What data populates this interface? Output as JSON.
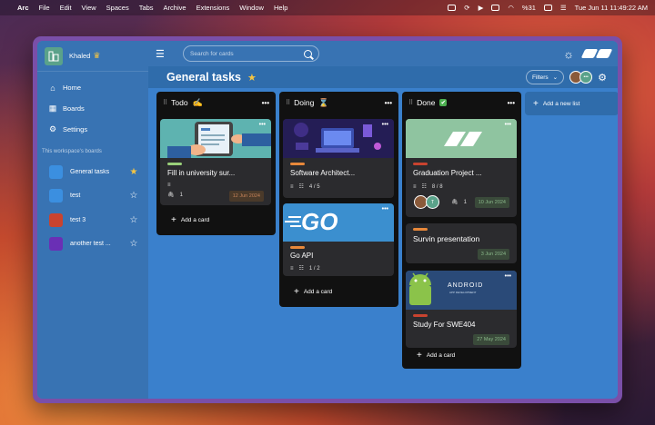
{
  "menubar": {
    "app": "Arc",
    "items": [
      "File",
      "Edit",
      "View",
      "Spaces",
      "Tabs",
      "Archive",
      "Extensions",
      "Window",
      "Help"
    ],
    "battery": "%31",
    "clock": "Tue Jun 11  11:49:22 AM"
  },
  "sidebar": {
    "workspace": "Khaled",
    "nav": [
      {
        "label": "Home",
        "icon": "home-icon"
      },
      {
        "label": "Boards",
        "icon": "boards-icon"
      },
      {
        "label": "Settings",
        "icon": "gear-icon"
      }
    ],
    "section_title": "This workspace's boards",
    "boards": [
      {
        "name": "General tasks",
        "color": "#3b8fe0",
        "starred": true
      },
      {
        "name": "test",
        "color": "#3b8fe0",
        "starred": false
      },
      {
        "name": "test 3",
        "color": "#c9432f",
        "starred": false
      },
      {
        "name": "another test ...",
        "color": "#6a2fb5",
        "starred": false
      }
    ]
  },
  "topbar": {
    "search_placeholder": "Search for cards"
  },
  "header": {
    "title": "General tasks",
    "filters": "Filters",
    "avatar_initial": "T"
  },
  "lists": [
    {
      "name": "Todo",
      "emoji": "✍️",
      "cards": [
        {
          "title": "Fill in university sur...",
          "label_color": "#9ad07a",
          "date": "12 Jun 2024",
          "attachments": "1"
        }
      ]
    },
    {
      "name": "Doing",
      "emoji": "⏳",
      "cards": [
        {
          "title": "Software Architect...",
          "label_color": "#e8883a",
          "checklist": "4 / 5"
        },
        {
          "title": "Go API",
          "label_color": "#e8883a",
          "checklist": "1 / 2",
          "image_text": "GO"
        }
      ]
    },
    {
      "name": "Done",
      "emoji": "✅",
      "cards": [
        {
          "title": "Graduation Project ...",
          "label_color": "#c9432f",
          "checklist": "8 / 8",
          "attachments": "1",
          "date": "10 Jun 2024",
          "avatar_initial": "T"
        },
        {
          "title": "Survin presentation",
          "label_color": "#e8883a",
          "date": "3 Jun 2024"
        },
        {
          "title": "Study For SWE404",
          "label_color": "#c9432f",
          "date": "27 May 2024",
          "image_text": "ANDROID",
          "image_subtext": "APP DEVELOPMENT"
        }
      ]
    }
  ],
  "add_card": "Add a card",
  "add_list": "Add a new list"
}
